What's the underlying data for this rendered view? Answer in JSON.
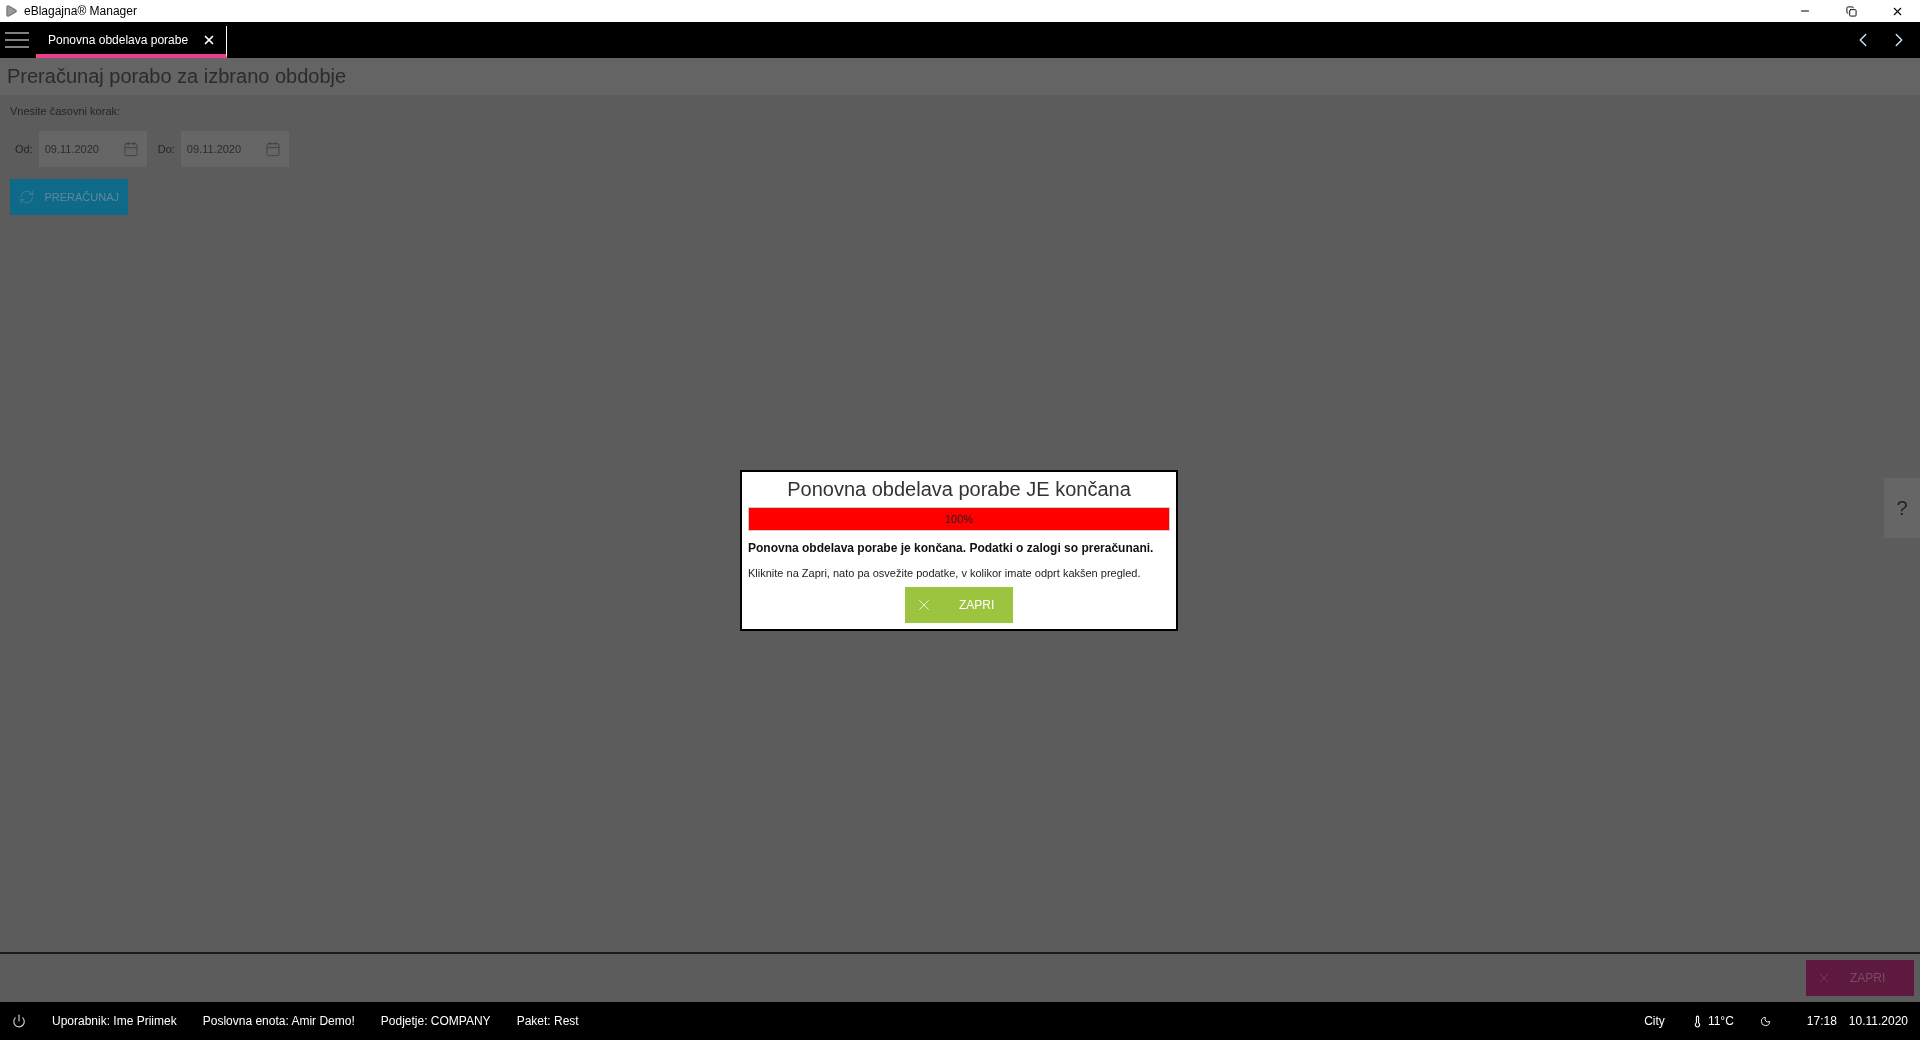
{
  "window": {
    "title": "eBlagajna® Manager"
  },
  "tabs": [
    {
      "label": "Ponovna obdelava porabe",
      "selected": true
    }
  ],
  "page": {
    "heading": "Preračunaj porabo za izbrano obdobje",
    "prompt": "Vnesite časovni korak:",
    "fields": [
      {
        "label": "Od:",
        "value": "09.11.2020"
      },
      {
        "label": "Do:",
        "value": "09.11.2020"
      }
    ],
    "action_button": "PRERAČUNAJ"
  },
  "help_tab": "?",
  "dialog": {
    "title": "Ponovna obdelava porabe JE končana",
    "progress": {
      "level": 1,
      "label": "100%"
    },
    "message": "Ponovna obdelava porabe je končana. Podatki o zalogi so preračunani.",
    "hint": "Kliknite na Zapri, nato pa osvežite podatke, v kolikor imate odprt kakšen pregled.",
    "button": "ZAPRI"
  },
  "footer": {
    "close_button": "ZAPRI"
  },
  "status_bar": {
    "items": [
      "Uporabnik: Ime Priimek",
      "Poslovna enota: Amir Demo!",
      "Podjetje: COMPANY",
      "Paket: Rest"
    ],
    "city": "City",
    "temperature": "11°C",
    "time": "17:18",
    "date": "10.11.2020"
  }
}
